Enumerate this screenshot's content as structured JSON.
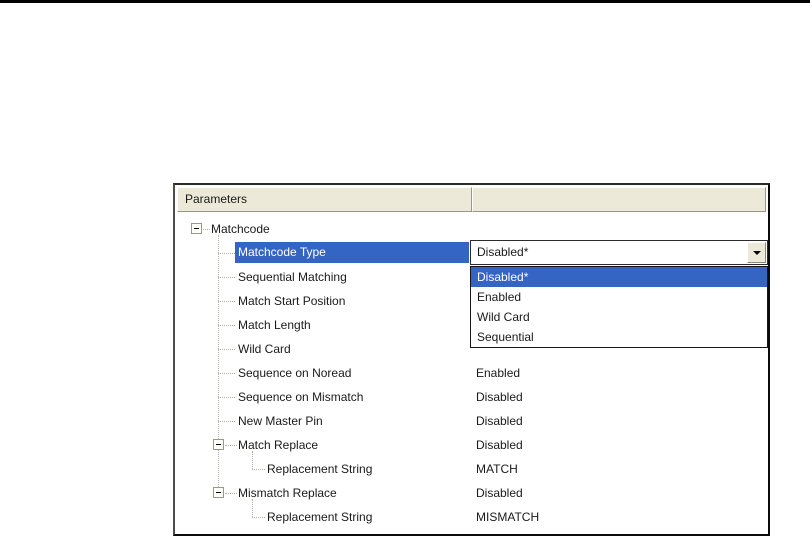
{
  "window": {
    "top_rule_color": "#000000",
    "background": "#ffffff"
  },
  "panel": {
    "colors": {
      "highlight": "#3465c4",
      "header_bg": "#ece9d8"
    },
    "header": {
      "columns": [
        "Parameters",
        ""
      ]
    },
    "tree": {
      "rows": [
        {
          "label": "Matchcode",
          "level": 0,
          "expander": "minus",
          "value": "",
          "selected": false
        },
        {
          "label": "Matchcode Type",
          "level": 1,
          "expander": null,
          "value": "",
          "selected": true,
          "control": "combobox"
        },
        {
          "label": "Sequential Matching",
          "level": 1,
          "expander": null,
          "value": "",
          "selected": false
        },
        {
          "label": "Match Start Position",
          "level": 1,
          "expander": null,
          "value": "",
          "selected": false
        },
        {
          "label": "Match Length",
          "level": 1,
          "expander": null,
          "value": "",
          "selected": false
        },
        {
          "label": "Wild Card",
          "level": 1,
          "expander": null,
          "value": "",
          "selected": false
        },
        {
          "label": "Sequence on Noread",
          "level": 1,
          "expander": null,
          "value": "Enabled",
          "selected": false
        },
        {
          "label": "Sequence on Mismatch",
          "level": 1,
          "expander": null,
          "value": "Disabled",
          "selected": false
        },
        {
          "label": "New Master Pin",
          "level": 1,
          "expander": null,
          "value": "Disabled",
          "selected": false
        },
        {
          "label": "Match Replace",
          "level": 1,
          "expander": "minus",
          "value": "Disabled",
          "selected": false
        },
        {
          "label": "Replacement String",
          "level": 2,
          "expander": null,
          "value": "MATCH",
          "selected": false
        },
        {
          "label": "Mismatch Replace",
          "level": 1,
          "expander": "minus",
          "value": "Disabled",
          "selected": false
        },
        {
          "label": "Replacement String",
          "level": 2,
          "expander": null,
          "value": "MISMATCH",
          "selected": false
        }
      ]
    },
    "combobox": {
      "value": "Disabled*"
    },
    "dropdown": {
      "options": [
        "Disabled*",
        "Enabled",
        "Wild Card",
        "Sequential"
      ],
      "selected_index": 0
    }
  }
}
